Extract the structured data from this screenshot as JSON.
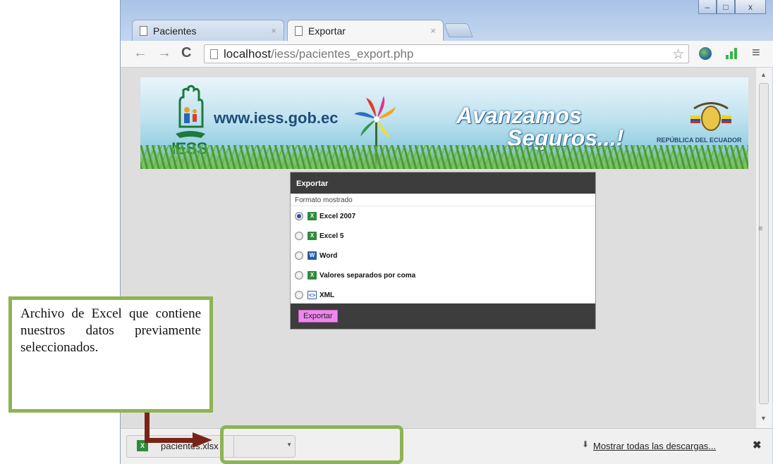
{
  "browser": {
    "tabs": [
      {
        "label": "Pacientes",
        "close": "×"
      },
      {
        "label": "Exportar",
        "close": "×"
      }
    ],
    "window_buttons": {
      "minimize": "–",
      "maximize": "□",
      "close": "x"
    },
    "nav": {
      "back": "←",
      "forward": "→",
      "reload": "C"
    },
    "url": {
      "host": "localhost",
      "path": "/iess/pacientes_export.php"
    },
    "icons": [
      "page-icon",
      "star-icon",
      "globe-extension-icon",
      "signal-bars-extension-icon",
      "menu-icon"
    ]
  },
  "banner": {
    "website": "www.iess.gob.ec",
    "logo_text": "IESS",
    "slogan_line1": "Avanzamos",
    "slogan_line2": "Seguros...!",
    "country": "REPÚBLICA DEL ECUADOR"
  },
  "export_dialog": {
    "title": "Exportar",
    "subtitle": "Formato mostrado",
    "options": [
      {
        "label": "Excel 2007",
        "icon": "excel-icon",
        "selected": true
      },
      {
        "label": "Excel 5",
        "icon": "excel-icon",
        "selected": false
      },
      {
        "label": "Word",
        "icon": "word-icon",
        "selected": false
      },
      {
        "label": "Valores separados por coma",
        "icon": "csv-icon",
        "selected": false
      },
      {
        "label": "XML",
        "icon": "xml-icon",
        "selected": false
      }
    ],
    "button_label": "Exportar"
  },
  "download_shelf": {
    "file_name": "pacientes.xlsx",
    "show_all": "Mostrar todas las descargas...",
    "close": "✖"
  },
  "annotation": {
    "text": "Archivo de Excel que contiene nuestros datos previamente seleccionados."
  },
  "colors": {
    "annotation_border": "#8db354",
    "arrow": "#7a2418",
    "dialog_header": "#3d3d3d",
    "export_button": "#ef88ec"
  }
}
